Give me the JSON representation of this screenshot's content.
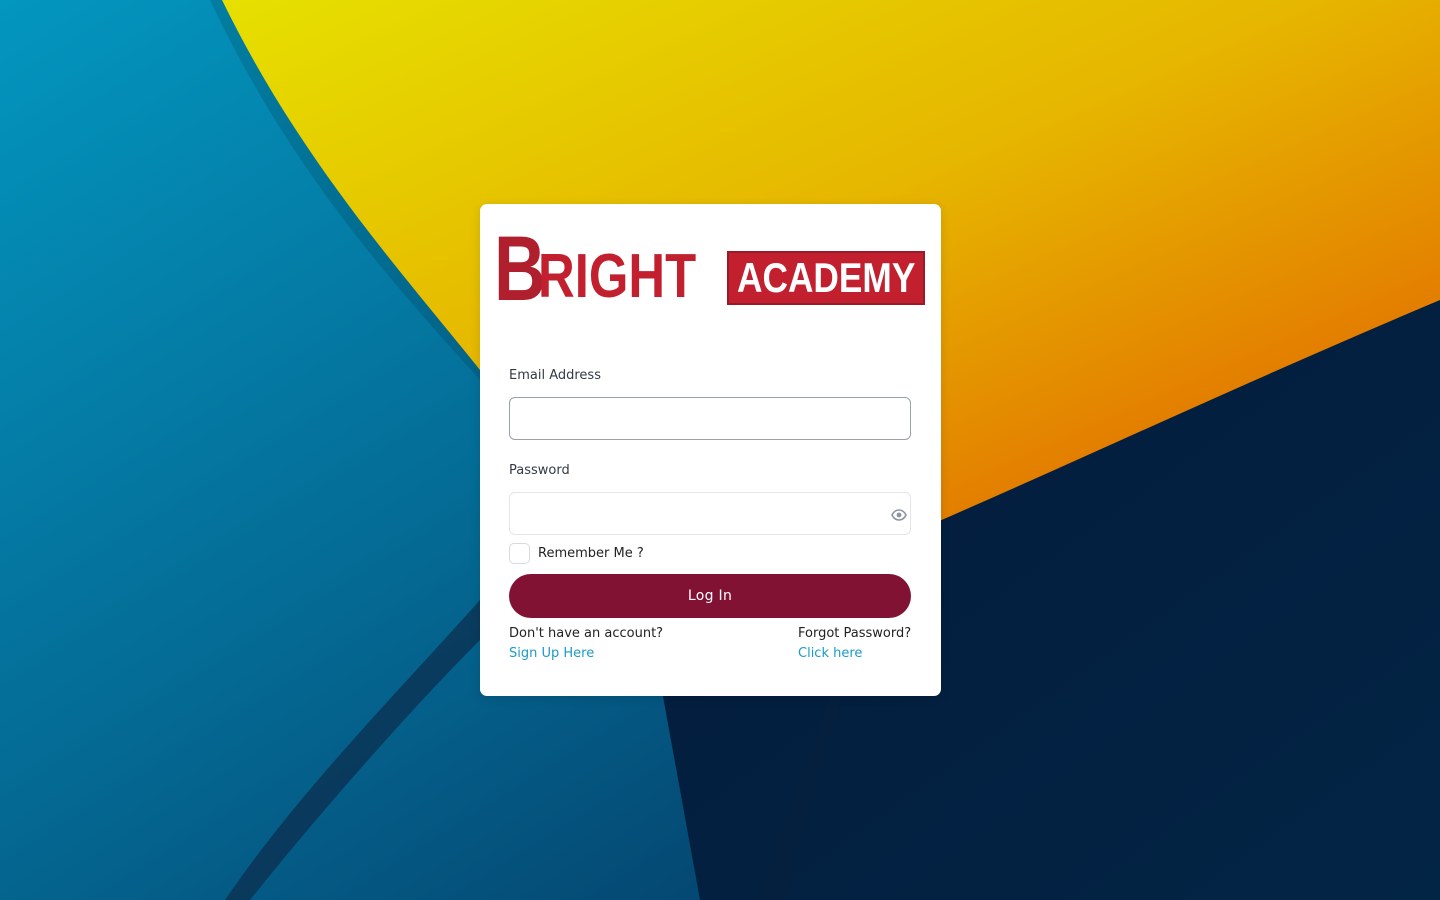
{
  "logo": {
    "big_letter": "B",
    "word_rest": "RIGHT",
    "box_text": "ACADEMY"
  },
  "form": {
    "email_label": "Email Address",
    "email_value": "",
    "password_label": "Password",
    "password_value": "",
    "remember_label": "Remember Me ?",
    "remember_checked": false,
    "login_label": "Log In"
  },
  "footer": {
    "no_account_text": "Don't have an account?",
    "signup_link": "Sign Up Here",
    "forgot_text": "Forgot Password?",
    "forgot_link": "Click here"
  },
  "colors": {
    "brand_red": "#c2202f",
    "button": "#811234",
    "link": "#1b9bc6"
  },
  "icons": {
    "password_toggle": "eye-icon"
  }
}
